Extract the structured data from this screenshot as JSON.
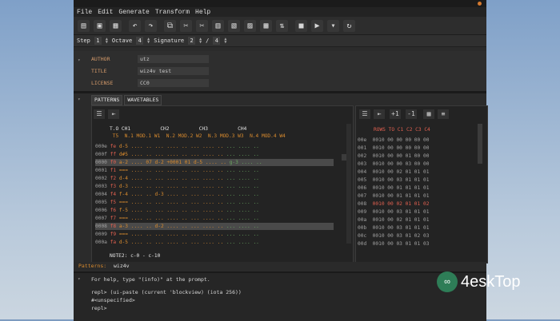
{
  "menu": [
    "File",
    "Edit",
    "Generate",
    "Transform",
    "Help"
  ],
  "toolbar_icons": [
    "new-file-icon",
    "open-icon",
    "save-icon",
    "undo-icon",
    "redo-icon",
    "copy-icon",
    "cut-icon",
    "cut-alt-icon",
    "paste-icon",
    "paste-alt-icon",
    "clipboard-icon",
    "clipboard-alt-icon",
    "swap-icon",
    "stop-icon",
    "play-icon",
    "dropdown-icon",
    "loop-icon"
  ],
  "stepbar": {
    "step_label": "Step",
    "step_val": "1",
    "octave_label": "Octave",
    "octave_val": "4",
    "signature_label": "Signature",
    "sig_a": "2",
    "slash": "/",
    "sig_b": "4"
  },
  "meta": {
    "author_label": "AUTHOR",
    "author_val": "utz",
    "title_label": "TITLE",
    "title_val": "wiz4v test",
    "license_label": "LICENSE",
    "license_val": "CC0"
  },
  "tabs": [
    "PATTERNS",
    "WAVETABLES"
  ],
  "patterns": {
    "header1": "T.O CH1          CH2          CH3          CH4",
    "header2": " T5  N.1 MOD.1 W1  N.2 MOD.2 W2  N.3 MOD.3 W3  N.4 MOD.4 W4",
    "rows": [
      [
        "000e",
        "fe",
        "d-5 .... ..",
        "... .... ..",
        "... .... ..",
        "... .... .."
      ],
      [
        "000f",
        "ff",
        "d#5 .... ..",
        "... .... ..",
        "... .... ..",
        "... .... .."
      ],
      [
        "0000",
        "f0",
        "a-2 .... 07",
        "d-2 +0001 01",
        "d-5 .... ..",
        "g-3 .... .."
      ],
      [
        "0001",
        "f1",
        "=== .... ..",
        "... .... ..",
        "... .... ..",
        "... .... .."
      ],
      [
        "0002",
        "f2",
        "d-4 .... ..",
        "... .... ..",
        "... .... ..",
        "... .... .."
      ],
      [
        "0003",
        "f3",
        "d-3 .... ..",
        "... .... ..",
        "... .... ..",
        "... .... .."
      ],
      [
        "0004",
        "f4",
        "f-4 .... ..",
        "d-3 .... ..",
        "... .... ..",
        "... .... .."
      ],
      [
        "0005",
        "f5",
        "=== .... ..",
        "... .... ..",
        "... .... ..",
        "... .... .."
      ],
      [
        "0006",
        "f6",
        "f-5 .... ..",
        "... .... ..",
        "... .... ..",
        "... .... .."
      ],
      [
        "0007",
        "f7",
        "=== .... ..",
        "... .... ..",
        "... .... ..",
        "... .... .."
      ],
      [
        "0008",
        "f8",
        "a-3 .... ..",
        "d-2 .... ..",
        "... .... ..",
        "... .... .."
      ],
      [
        "0009",
        "f9",
        "=== .... ..",
        "... .... ..",
        "... .... ..",
        "... .... .."
      ],
      [
        "000a",
        "fa",
        "d-5 .... ..",
        "... .... ..",
        "... .... ..",
        "... .... .."
      ]
    ],
    "footer": "NOTE2: c-0 - c-10"
  },
  "sequence": {
    "header": "ROWS TO C1 C2 C3 C4",
    "rows": [
      [
        "00e",
        "0010 00 00 00 00 00"
      ],
      [
        "001",
        "0010 00 00 00 00 00"
      ],
      [
        "002",
        "0010 00 00 01 00 00"
      ],
      [
        "003",
        "0010 00 00 03 00 00"
      ],
      [
        "004",
        "0010 00 02 01 01 01"
      ],
      [
        "005",
        "0010 00 03 01 01 01"
      ],
      [
        "006",
        "0010 00 01 01 01 01"
      ],
      [
        "007",
        "0010 00 01 01 01 01"
      ],
      [
        "008",
        "0010 00 02 01 01 02"
      ],
      [
        "009",
        "0010 00 03 01 01 01"
      ],
      [
        "00a",
        "0010 00 02 01 01 01"
      ],
      [
        "00b",
        "0010 00 03 01 01 01"
      ],
      [
        "00c",
        "0010 00 03 01 02 03"
      ],
      [
        "00d",
        "0010 00 03 01 01 03"
      ]
    ]
  },
  "status": {
    "label": "Patterns:",
    "value": "wiz4v"
  },
  "console": [
    "For help, type \"(info)\" at the prompt.",
    "repl> (ui-paste (current 'blockview) (iota 256))",
    "#<unspecified>",
    "repl>"
  ],
  "watermark": "4eskTop"
}
